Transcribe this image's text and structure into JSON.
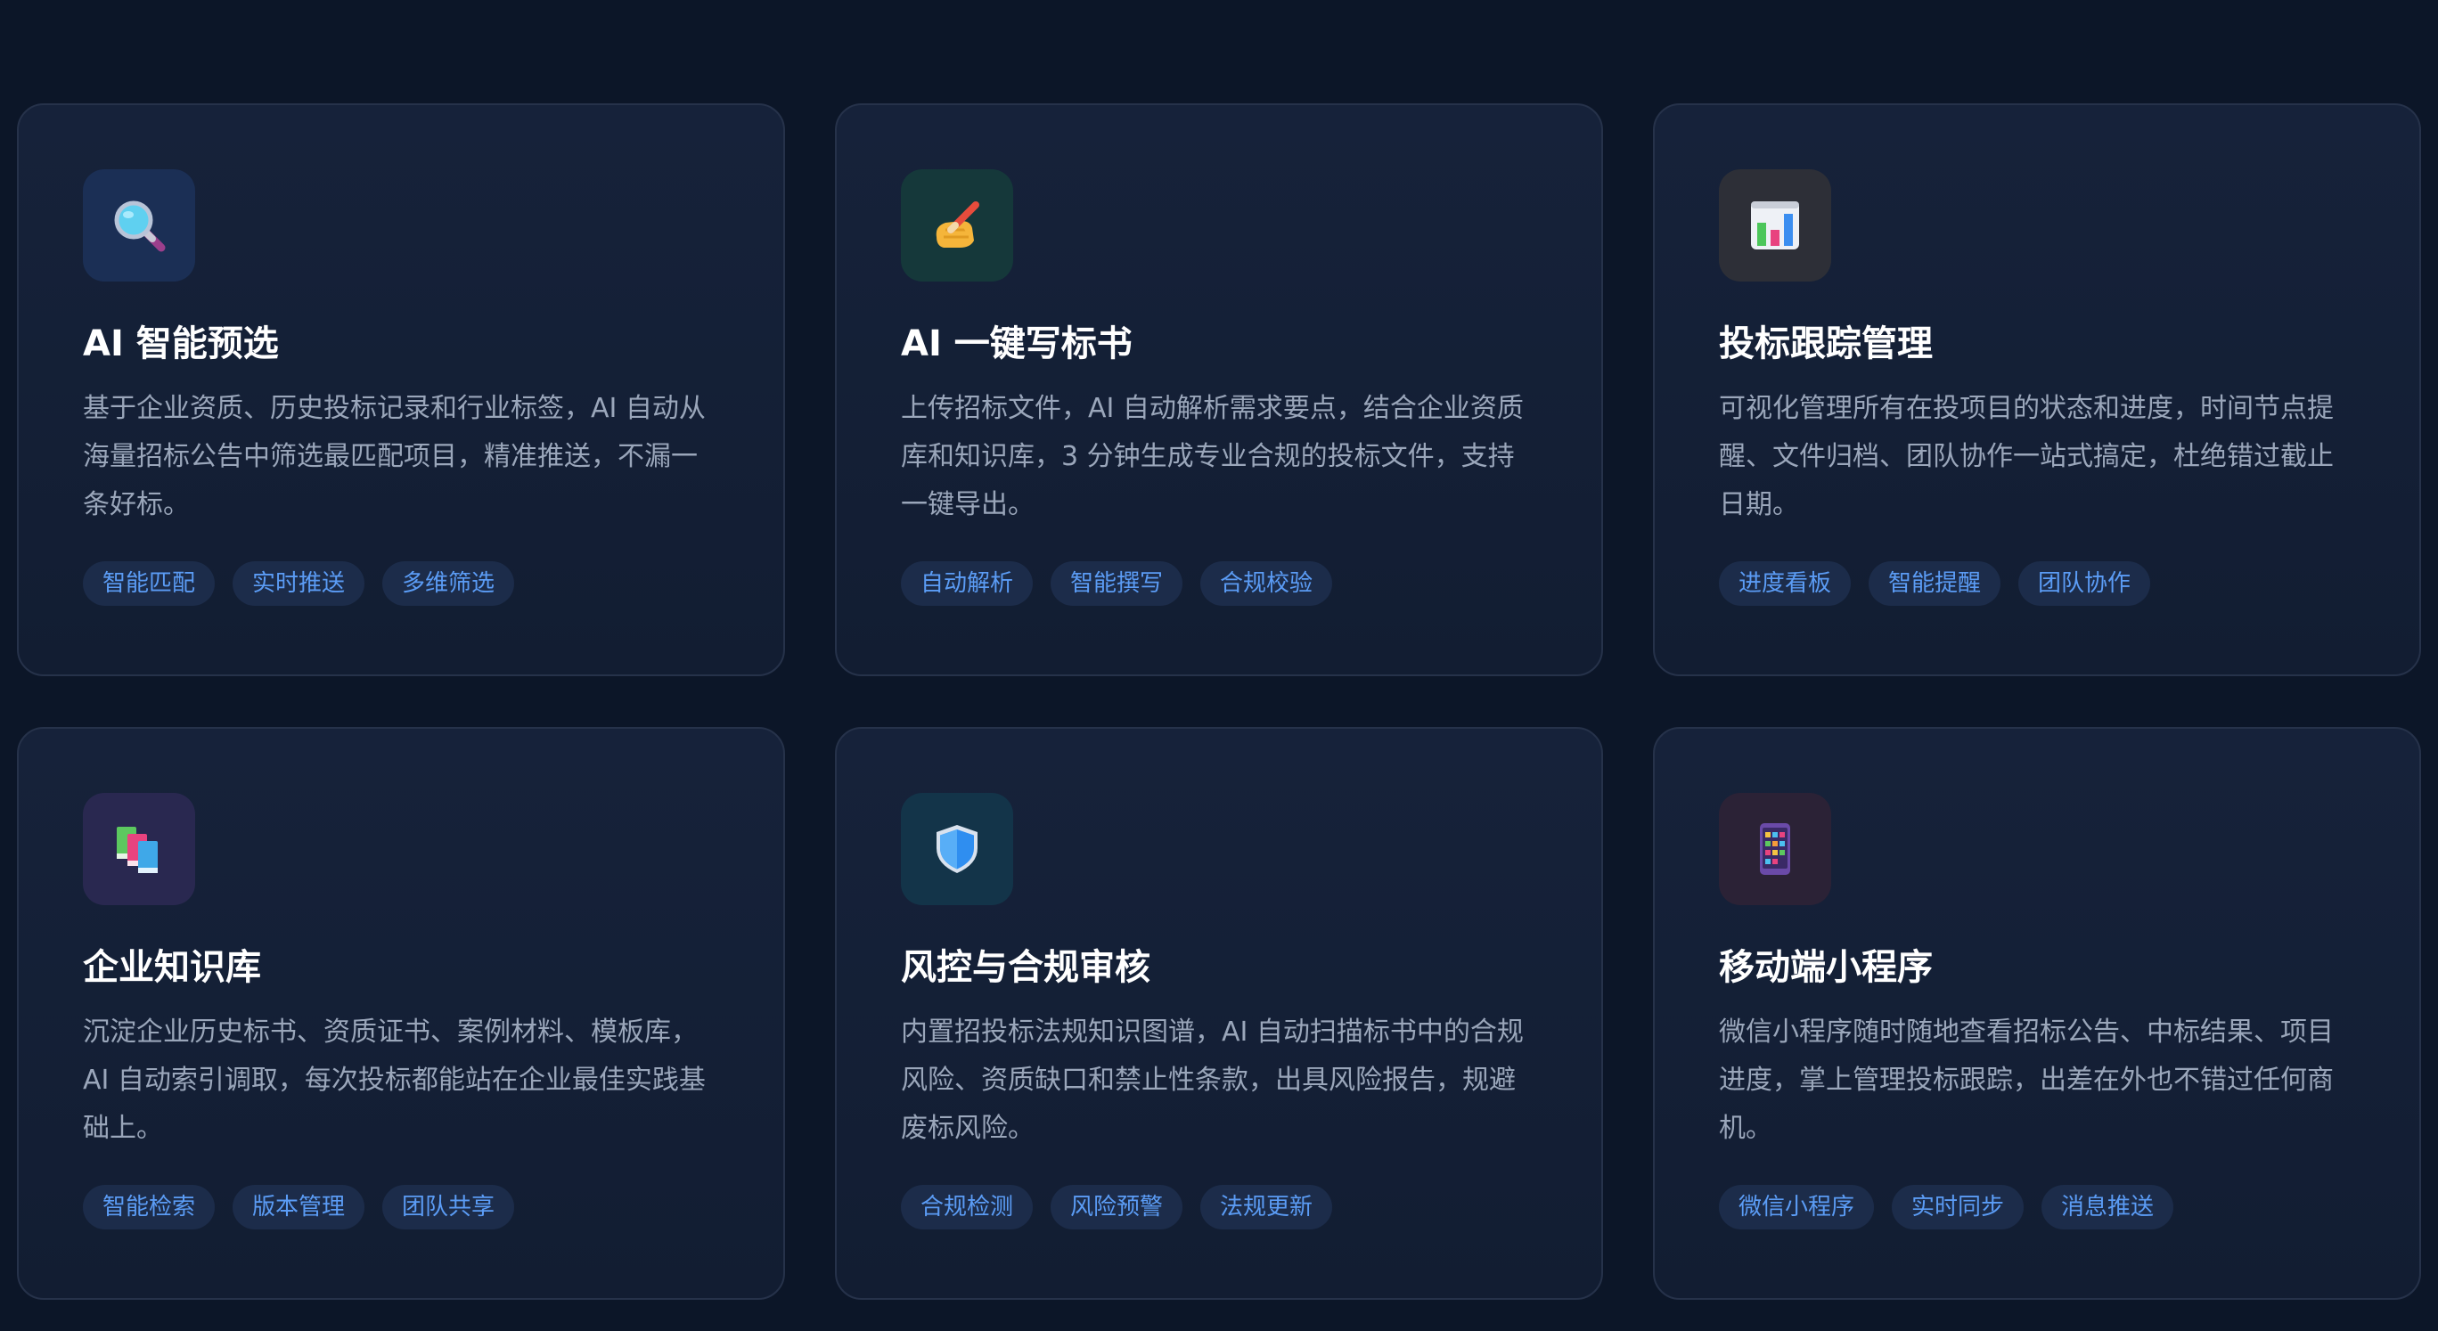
{
  "features": [
    {
      "icon": "magnifier-icon",
      "icon_bg": "#1b2f55",
      "title": "AI 智能预选",
      "description": "基于企业资质、历史投标记录和行业标签，AI 自动从海量招标公告中筛选最匹配项目，精准推送，不漏一条好标。",
      "tags": [
        "智能匹配",
        "实时推送",
        "多维筛选"
      ]
    },
    {
      "icon": "writing-hand-icon",
      "icon_bg": "#15383a",
      "title": "AI 一键写标书",
      "description": "上传招标文件，AI 自动解析需求要点，结合企业资质库和知识库，3 分钟生成专业合规的投标文件，支持一键导出。",
      "tags": [
        "自动解析",
        "智能撰写",
        "合规校验"
      ]
    },
    {
      "icon": "bar-chart-icon",
      "icon_bg": "#2d2f37",
      "title": "投标跟踪管理",
      "description": "可视化管理所有在投项目的状态和进度，时间节点提醒、文件归档、团队协作一站式搞定，杜绝错过截止日期。",
      "tags": [
        "进度看板",
        "智能提醒",
        "团队协作"
      ]
    },
    {
      "icon": "books-icon",
      "icon_bg": "#292850",
      "title": "企业知识库",
      "description": "沉淀企业历史标书、资质证书、案例材料、模板库，AI 自动索引调取，每次投标都能站在企业最佳实践基础上。",
      "tags": [
        "智能检索",
        "版本管理",
        "团队共享"
      ]
    },
    {
      "icon": "shield-icon",
      "icon_bg": "#133449",
      "title": "风控与合规审核",
      "description": "内置招投标法规知识图谱，AI 自动扫描标书中的合规风险、资质缺口和禁止性条款，出具风险报告，规避废标风险。",
      "tags": [
        "合规检测",
        "风险预警",
        "法规更新"
      ]
    },
    {
      "icon": "mobile-app-icon",
      "icon_bg": "#2b2236",
      "title": "移动端小程序",
      "description": "微信小程序随时随地查看招标公告、中标结果、项目进度，掌上管理投标跟踪，出差在外也不错过任何商机。",
      "tags": [
        "微信小程序",
        "实时同步",
        "消息推送"
      ]
    }
  ]
}
